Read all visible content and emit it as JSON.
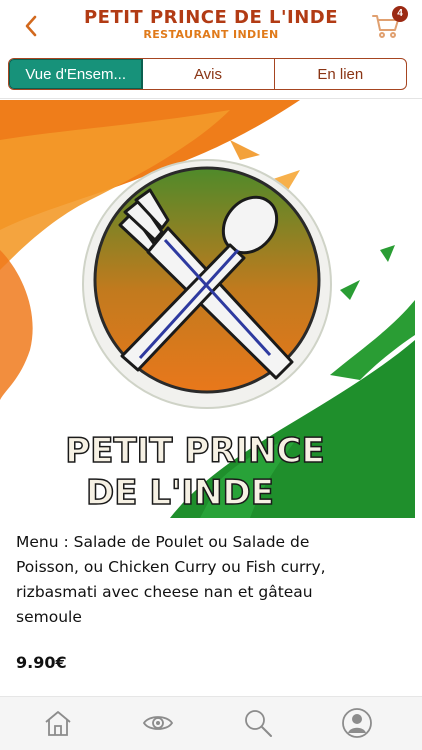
{
  "header": {
    "title": "PETIT PRINCE DE L'INDE",
    "subtitle": "RESTAURANT INDIEN",
    "cart_count": "4",
    "accent": "#b23b14"
  },
  "tabs": [
    {
      "label": "Vue d'Ensem...",
      "active": true
    },
    {
      "label": "Avis",
      "active": false
    },
    {
      "label": "En lien",
      "active": false
    }
  ],
  "hero": {
    "logo_line1": "PETIT PRINCE",
    "logo_line2": "DE L'INDE",
    "icon": "fork-spoon-logo"
  },
  "product": {
    "description": "Menu : Salade de Poulet ou Salade de Poisson, ou Chicken Curry ou Fish curry, rizbasmati avec cheese nan et gâteau semoule",
    "price": "9.90€"
  },
  "bottom_nav": [
    {
      "name": "home-icon"
    },
    {
      "name": "eye-icon"
    },
    {
      "name": "search-icon"
    },
    {
      "name": "profile-icon"
    }
  ]
}
